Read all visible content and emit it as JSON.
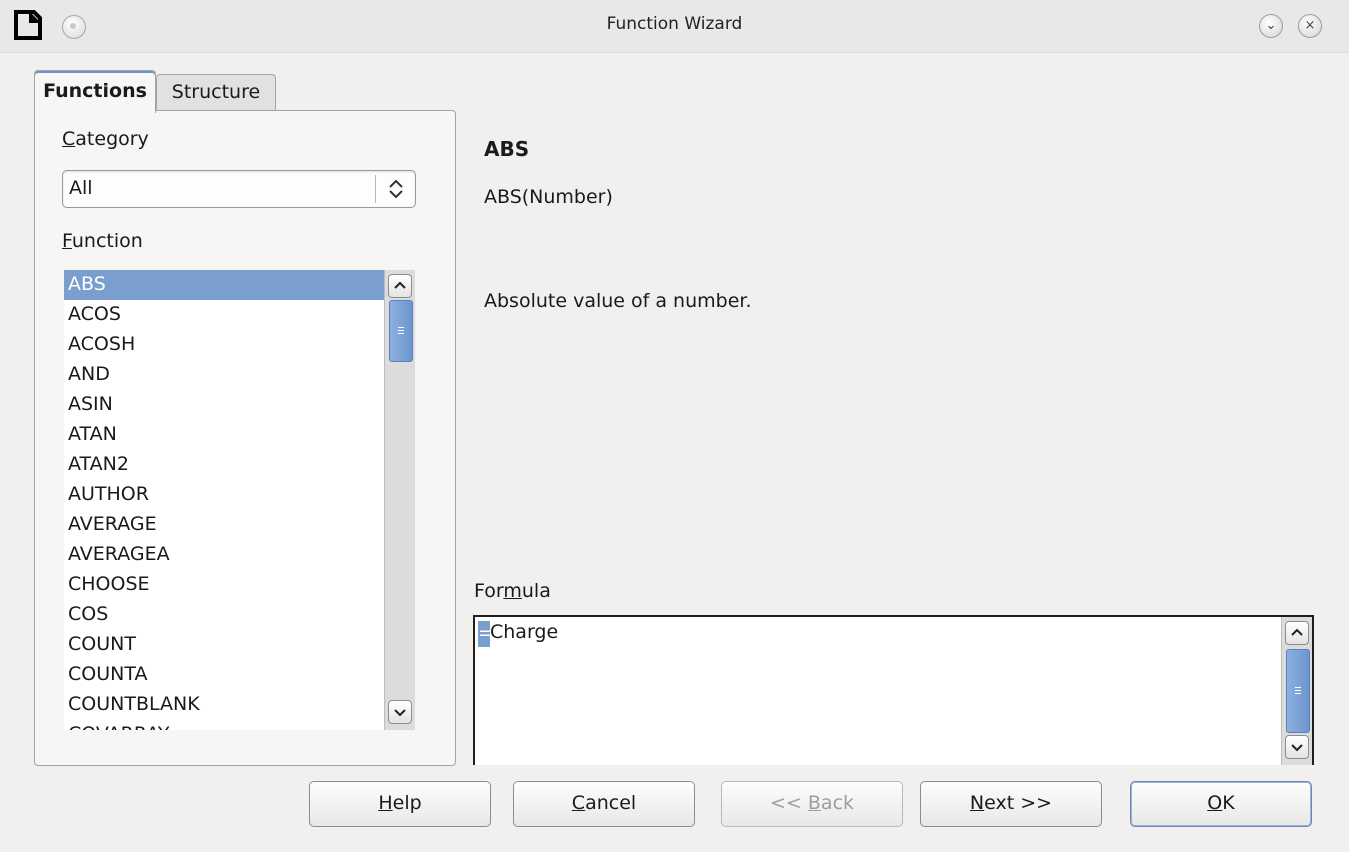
{
  "window": {
    "title": "Function Wizard",
    "minimize_glyph": "⌄",
    "close_glyph": "×"
  },
  "tabs": [
    {
      "label": "Functions",
      "active": true
    },
    {
      "label": "Structure",
      "active": false
    }
  ],
  "category": {
    "label_mnemonic": "C",
    "label_rest": "ategory",
    "selected": "All"
  },
  "function": {
    "label_mnemonic": "F",
    "label_rest": "unction",
    "items": [
      "ABS",
      "ACOS",
      "ACOSH",
      "AND",
      "ASIN",
      "ATAN",
      "ATAN2",
      "AUTHOR",
      "AVERAGE",
      "AVERAGEA",
      "CHOOSE",
      "COS",
      "COUNT",
      "COUNTA",
      "COUNTBLANK",
      "COVARRAY"
    ],
    "selected": "ABS"
  },
  "details": {
    "name": "ABS",
    "syntax": "ABS(Number)",
    "description": "Absolute value of a number."
  },
  "formula": {
    "label_before": "For",
    "label_mnemonic": "m",
    "label_after": "ula",
    "cursor_char": "=",
    "value": "Charge"
  },
  "buttons": {
    "help": {
      "mnemonic": "H",
      "rest": "elp"
    },
    "cancel": {
      "mnemonic": "C",
      "rest": "ancel"
    },
    "back": {
      "before": "<< ",
      "mnemonic": "B",
      "rest": "ack"
    },
    "next": {
      "mnemonic": "N",
      "rest": "ext >>"
    },
    "ok": {
      "mnemonic": "O",
      "rest": "K"
    }
  },
  "colors": {
    "selection": "#7a9fcf",
    "background": "#f1f0ef",
    "scroll_thumb": "#6d95ce"
  }
}
